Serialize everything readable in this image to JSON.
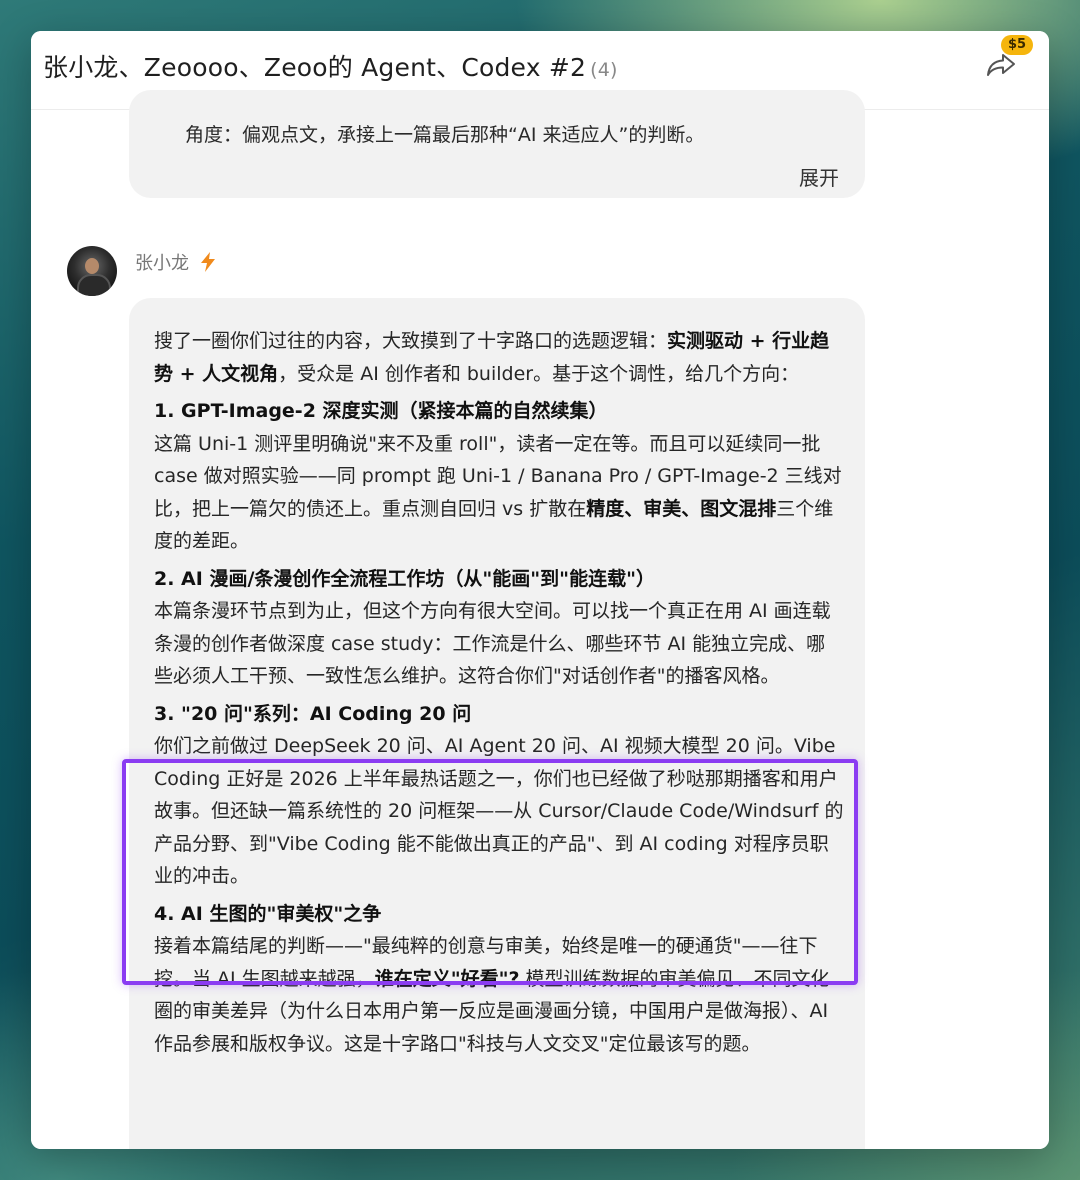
{
  "header": {
    "title": "张小龙、Zeoooo、Zeoo的 Agent、Codex #2",
    "member_count": "(4)",
    "price_badge": "$5",
    "share_icon": "share-arrow-icon"
  },
  "previous_message": {
    "text": "角度：偏观点文，承接上一篇最后那种“AI 来适应人”的判断。",
    "expand_label": "展开"
  },
  "message": {
    "sender_name": "张小龙",
    "sender_badge_icon": "lightning-icon",
    "intro": {
      "lead": "搜了一圈你们过往的内容，大致摸到了十字路口的选题逻辑：",
      "bold": "实测驱动 + 行业趋势 + 人文视角",
      "tail": "，受众是 AI 创作者和 builder。基于这个调性，给几个方向："
    },
    "items": [
      {
        "title": "1. GPT-Image-2 深度实测（紧接本篇的自然续集）",
        "body_lead": "这篇 Uni-1 测评里明确说\"来不及重 roll\"，读者一定在等。而且可以延续同一批 case 做对照实验——同 prompt 跑 Uni-1 / Banana Pro / GPT-Image-2 三线对比，把上一篇欠的债还上。重点测自回归 vs 扩散在",
        "body_bold": "精度、审美、图文混排",
        "body_tail": "三个维度的差距。"
      },
      {
        "title": "2. AI 漫画/条漫创作全流程工作坊（从\"能画\"到\"能连载\"）",
        "body": "本篇条漫环节点到为止，但这个方向有很大空间。可以找一个真正在用 AI 画连载条漫的创作者做深度 case study：工作流是什么、哪些环节 AI 能独立完成、哪些必须人工干预、一致性怎么维护。这符合你们\"对话创作者\"的播客风格。"
      },
      {
        "title": "3. \"20 问\"系列：AI Coding 20 问",
        "body": "你们之前做过 DeepSeek 20 问、AI Agent 20 问、AI 视频大模型 20 问。Vibe Coding 正好是 2026 上半年最热话题之一，你们也已经做了秒哒那期播客和用户故事。但还缺一篇系统性的 20 问框架——从 Cursor/Claude Code/Windsurf 的产品分野、到\"Vibe Coding 能不能做出真正的产品\"、到 AI coding 对程序员职业的冲击。"
      },
      {
        "title": "4. AI 生图的\"审美权\"之争",
        "body_lead": "接着本篇结尾的判断——\"最纯粹的创意与审美，始终是唯一的硬通货\"——往下挖。当 AI 生图越来越强，",
        "body_bold": "谁在定义\"好看\"?",
        "body_tail": " 模型训练数据的审美偏见、不同文化圈的审美差异（为什么日本用户第一反应是画漫画分镜，中国用户是做海报）、AI 作品参展和版权争议。这是十字路口\"科技与人文交叉\"定位最该写的题。"
      }
    ]
  },
  "colors": {
    "highlight": "#8b3cf2",
    "badge": "#f5b50d",
    "bolt": "#f08a1c",
    "bubble": "#f2f2f2"
  }
}
